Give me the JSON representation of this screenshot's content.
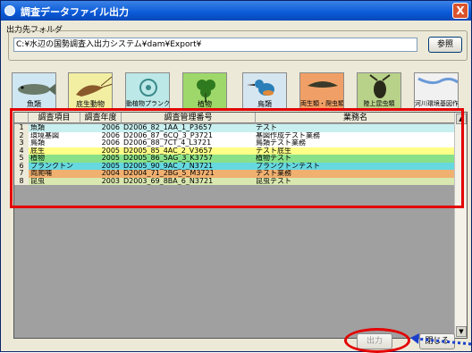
{
  "window": {
    "title": "調査データファイル出力",
    "close_label": "X"
  },
  "output_folder": {
    "label": "出力先フォルダ",
    "path": "C:¥水辺の国勢調査入出力システム¥dam¥Export¥",
    "browse_label": "参照"
  },
  "categories": [
    {
      "label": "魚類",
      "icon": "fish-icon",
      "bg": "#cfe7f2"
    },
    {
      "label": "底生動物",
      "icon": "shrimp-icon",
      "bg": "#f2efa2"
    },
    {
      "label": "動植物プランクトン",
      "icon": "plankton-icon",
      "bg": "#bde8e8"
    },
    {
      "label": "植物",
      "icon": "clover-icon",
      "bg": "#9fd86a"
    },
    {
      "label": "鳥類",
      "icon": "kingfisher-icon",
      "bg": "#d6e6f0"
    },
    {
      "label": "両生類・爬虫類・哺乳類",
      "icon": "lizard-icon",
      "bg": "#f0a066"
    },
    {
      "label": "陸上昆虫類",
      "icon": "beetle-icon",
      "bg": "#b9d28a"
    },
    {
      "label": "河川環境基図作成調査",
      "icon": "map-icon",
      "bg": "#f1f1f1"
    }
  ],
  "table": {
    "columns": [
      "調査項目",
      "調査年度",
      "調査管理番号",
      "業務名"
    ],
    "rows": [
      {
        "no": "1",
        "item": "魚類",
        "year": "2006",
        "id": "D2006_82_1AA_1_P3657",
        "task": "テスト",
        "bg": "#c8f0f0"
      },
      {
        "no": "2",
        "item": "環境基図",
        "year": "2006",
        "id": "D2006_87_6CQ_3_P3721",
        "task": "基図作成テスト業務",
        "bg": "#ffffff"
      },
      {
        "no": "3",
        "item": "鳥類",
        "year": "2006",
        "id": "D2006_88_7CT_4_L3721",
        "task": "鳥類テスト業務",
        "bg": "#ffffff"
      },
      {
        "no": "4",
        "item": "底生",
        "year": "2005",
        "id": "D2005_85_4AC_2_V3657",
        "task": "テスト底生",
        "bg": "#ffff88"
      },
      {
        "no": "5",
        "item": "植物",
        "year": "2005",
        "id": "D2005_86_5AG_3_K3757",
        "task": "植物テスト",
        "bg": "#88e088"
      },
      {
        "no": "6",
        "item": "プランクトン",
        "year": "2005",
        "id": "D2005_90_9AC_7_N3721",
        "task": "プランクトンテスト",
        "bg": "#66d8e0"
      },
      {
        "no": "7",
        "item": "両爬哺",
        "year": "2004",
        "id": "D2004_71_2BG_5_M3721",
        "task": "テスト業務",
        "bg": "#f0b070"
      },
      {
        "no": "8",
        "item": "昆虫",
        "year": "2003",
        "id": "D2003_69_8BA_6_N3721",
        "task": "昆虫テスト",
        "bg": "#d8e8b0"
      }
    ]
  },
  "buttons": {
    "output_label": "出力",
    "close_label": "閉じる"
  }
}
